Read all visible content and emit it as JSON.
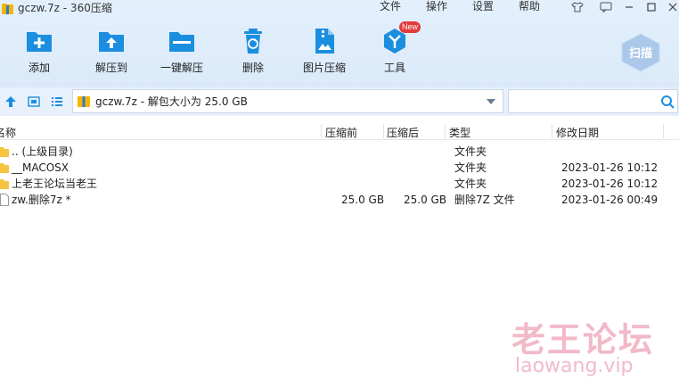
{
  "window": {
    "title": "gczw.7z - 360压缩",
    "menu": [
      "文件",
      "操作",
      "设置",
      "帮助"
    ]
  },
  "toolbar": {
    "items": [
      {
        "label": "添加",
        "icon": "add-icon"
      },
      {
        "label": "解压到",
        "icon": "extract-to-icon"
      },
      {
        "label": "一键解压",
        "icon": "one-click-extract-icon"
      },
      {
        "label": "删除",
        "icon": "delete-icon"
      },
      {
        "label": "图片压缩",
        "icon": "image-compress-icon"
      },
      {
        "label": "工具",
        "icon": "tools-icon"
      }
    ],
    "new_badge": "New",
    "scan_label": "扫描"
  },
  "address": {
    "path": "gczw.7z - 解包大小为 25.0 GB",
    "search_placeholder": ""
  },
  "list": {
    "columns": [
      "名称",
      "压缩前",
      "压缩后",
      "类型",
      "修改日期"
    ],
    "rows": [
      {
        "name": ".. (上级目录)",
        "before": "",
        "after": "",
        "type": "文件夹",
        "date": "",
        "kind": "folder"
      },
      {
        "name": "__MACOSX",
        "before": "",
        "after": "",
        "type": "文件夹",
        "date": "2023-01-26 10:12",
        "kind": "folder"
      },
      {
        "name": "上老王论坛当老王",
        "before": "",
        "after": "",
        "type": "文件夹",
        "date": "2023-01-26 10:12",
        "kind": "folder"
      },
      {
        "name": "zw.删除7z *",
        "before": "25.0 GB",
        "after": "25.0 GB",
        "type": "删除7Z 文件",
        "date": "2023-01-26 00:49",
        "kind": "file"
      }
    ]
  },
  "watermark": {
    "line1": "老王论坛",
    "line2": "laowang.vip"
  },
  "colors": {
    "accent": "#1c8ee0",
    "toolbar_bg": "#dbeafa",
    "folder": "#f6c343",
    "badge": "#e33b3b",
    "watermark": "#f2b9c8"
  }
}
